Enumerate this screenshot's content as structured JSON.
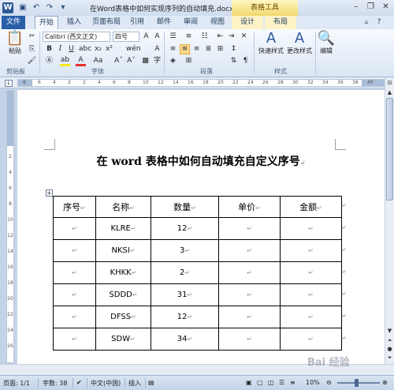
{
  "window": {
    "title": "在Word表格中如何实现序列的自动填充.docx M...",
    "context_tab_title": "表格工具",
    "qat_icons": [
      "save-icon",
      "undo-icon",
      "redo-icon",
      "customize-icon"
    ]
  },
  "ribbon": {
    "tabs": [
      "文件",
      "开始",
      "插入",
      "页面布局",
      "引用",
      "邮件",
      "审阅",
      "视图",
      "设计",
      "布局"
    ],
    "clipboard": {
      "paste": "粘贴",
      "label": "剪贴板"
    },
    "font": {
      "name": "Calibri (西文正文)",
      "size": "四号",
      "label": "字体",
      "wen": "wén",
      "a_upper": "A",
      "font_color": "A",
      "aa": "Aa",
      "clear_format": "A",
      "border_a": "A",
      "circle_char": "字"
    },
    "paragraph": {
      "label": "段落"
    },
    "styles": {
      "quick": "快速样式",
      "change": "更改样式",
      "label": "样式"
    },
    "editing": {
      "label": "编辑"
    }
  },
  "ruler": {
    "h_ticks": [
      "8",
      "6",
      "4",
      "2",
      "2",
      "4",
      "6",
      "8",
      "10",
      "12",
      "14",
      "16",
      "18",
      "20",
      "22",
      "24",
      "26",
      "28",
      "30",
      "32",
      "34",
      "36",
      "38",
      "40"
    ],
    "v_ticks": [
      "2",
      "4",
      "6",
      "8",
      "10",
      "12",
      "14",
      "16",
      "18",
      "20",
      "22",
      "24",
      "26"
    ]
  },
  "document": {
    "heading": "在 word 表格中如何自动填充自定义序号",
    "table": {
      "headers": [
        "序号",
        "名称",
        "数量",
        "单价",
        "金额"
      ],
      "rows": [
        [
          "",
          "KLRE",
          "12",
          "",
          ""
        ],
        [
          "",
          "NKSI",
          "3",
          "",
          ""
        ],
        [
          "",
          "KHKK",
          "2",
          "",
          ""
        ],
        [
          "",
          "SDDD",
          "31",
          "",
          ""
        ],
        [
          "",
          "DFSS",
          "12",
          "",
          ""
        ],
        [
          "",
          "SDW",
          "34",
          "",
          ""
        ]
      ]
    }
  },
  "status": {
    "page": "页面: 1/1",
    "words": "字数: 38",
    "language": "中文(中国)",
    "mode": "插入",
    "zoom": "10%"
  },
  "watermark": "Bai 经验"
}
